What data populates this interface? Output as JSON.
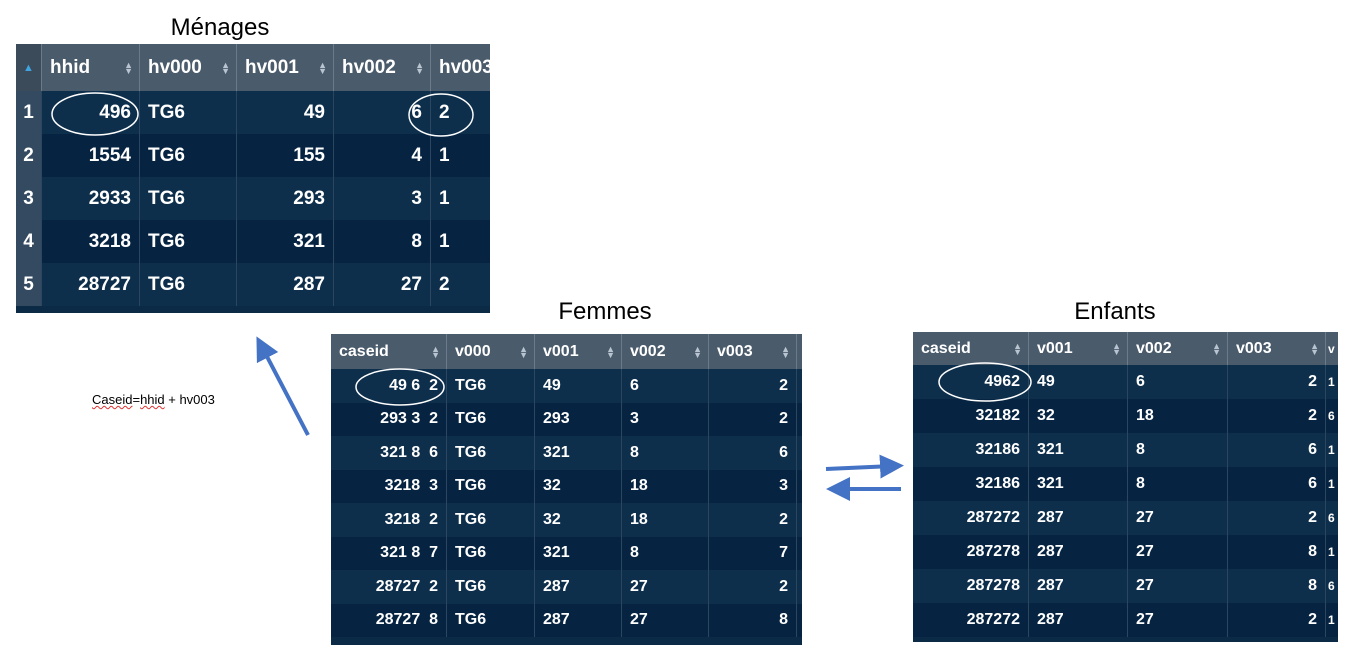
{
  "titles": {
    "menages": "Ménages",
    "femmes": "Femmes",
    "enfants": "Enfants"
  },
  "note": {
    "underlined": "Caseid",
    "eq": "=",
    "underlined2": "hhid",
    "rest": " + hv003"
  },
  "menages": {
    "columns": [
      "",
      "hhid",
      "hv000",
      "hv001",
      "hv002",
      "hv003"
    ],
    "rows": [
      [
        "1",
        "496",
        "TG6",
        "49",
        "6",
        "2"
      ],
      [
        "2",
        "1554",
        "TG6",
        "155",
        "4",
        "1"
      ],
      [
        "3",
        "2933",
        "TG6",
        "293",
        "3",
        "1"
      ],
      [
        "4",
        "3218",
        "TG6",
        "321",
        "8",
        "1"
      ],
      [
        "5",
        "28727",
        "TG6",
        "287",
        "27",
        "2"
      ]
    ]
  },
  "femmes": {
    "columns": [
      "caseid",
      "v000",
      "v001",
      "v002",
      "v003"
    ],
    "rows": [
      [
        "49 6  2",
        "TG6",
        "49",
        "6",
        "2"
      ],
      [
        "293 3  2",
        "TG6",
        "293",
        "3",
        "2"
      ],
      [
        "321 8  6",
        "TG6",
        "321",
        "8",
        "6"
      ],
      [
        "3218  3",
        "TG6",
        "32",
        "18",
        "3"
      ],
      [
        "3218  2",
        "TG6",
        "32",
        "18",
        "2"
      ],
      [
        "321 8  7",
        "TG6",
        "321",
        "8",
        "7"
      ],
      [
        "28727  2",
        "TG6",
        "287",
        "27",
        "2"
      ],
      [
        "28727  8",
        "TG6",
        "287",
        "27",
        "8"
      ]
    ]
  },
  "enfants": {
    "columns": [
      "caseid",
      "v001",
      "v002",
      "v003",
      "v"
    ],
    "rows": [
      [
        "4962",
        "49",
        "6",
        "2",
        "1"
      ],
      [
        "32182",
        "32",
        "18",
        "2",
        "6"
      ],
      [
        "32186",
        "321",
        "8",
        "6",
        "1"
      ],
      [
        "32186",
        "321",
        "8",
        "6",
        "1"
      ],
      [
        "287272",
        "287",
        "27",
        "2",
        "6"
      ],
      [
        "287278",
        "287",
        "27",
        "8",
        "1"
      ],
      [
        "287278",
        "287",
        "27",
        "8",
        "6"
      ],
      [
        "287272",
        "287",
        "27",
        "2",
        "1"
      ]
    ]
  },
  "colors": {
    "arrow": "#4472c4",
    "header_bg": "#4a5b6c",
    "row_bg": "#0e2f4c"
  }
}
